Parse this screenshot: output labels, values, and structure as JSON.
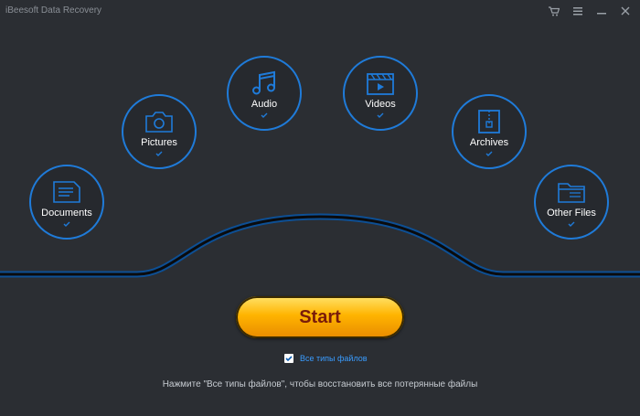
{
  "app": {
    "title": "iBeesoft Data Recovery"
  },
  "window_controls": [
    {
      "icon": "cart-icon"
    },
    {
      "icon": "menu-icon"
    },
    {
      "icon": "minimize-icon"
    },
    {
      "icon": "close-icon"
    }
  ],
  "categories": {
    "documents": {
      "label": "Documents",
      "selected": true,
      "icon": "document-icon"
    },
    "pictures": {
      "label": "Pictures",
      "selected": true,
      "icon": "camera-icon"
    },
    "audio": {
      "label": "Audio",
      "selected": true,
      "icon": "music-note-icon"
    },
    "videos": {
      "label": "Videos",
      "selected": true,
      "icon": "video-icon"
    },
    "archives": {
      "label": "Archives",
      "selected": true,
      "icon": "archive-icon"
    },
    "other": {
      "label": "Other Files",
      "selected": true,
      "icon": "folder-icon"
    }
  },
  "start_button": {
    "label": "Start"
  },
  "all_types": {
    "label": "Все типы файлов",
    "checked": true
  },
  "hint": "Нажмите \"Все типы файлов\", чтобы восстановить все потерянные файлы",
  "colors": {
    "accent": "#1f7bd9",
    "background": "#2b2e33",
    "start": "#ffb400",
    "start_text": "#7a1c0a"
  }
}
